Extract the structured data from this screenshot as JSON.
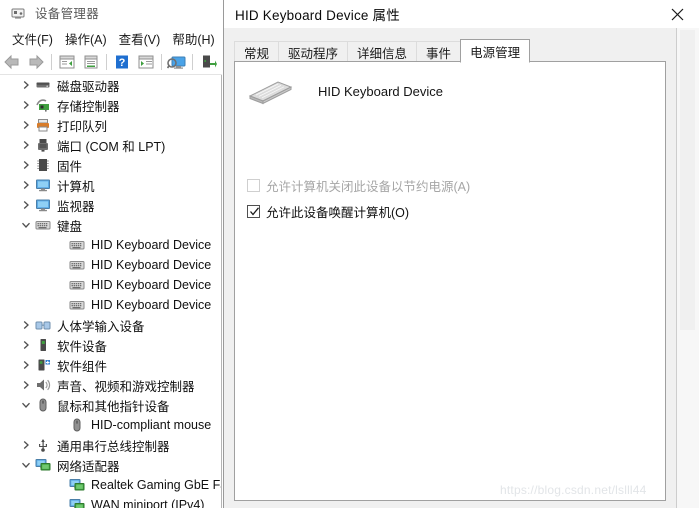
{
  "devmgr": {
    "title": "设备管理器",
    "title_icon": "device-manager-icon",
    "menu": [
      {
        "label": "文件(F)",
        "name": "menu-file"
      },
      {
        "label": "操作(A)",
        "name": "menu-action"
      },
      {
        "label": "查看(V)",
        "name": "menu-view"
      },
      {
        "label": "帮助(H)",
        "name": "menu-help"
      }
    ],
    "toolbar": [
      {
        "name": "back-arrow-icon",
        "kind": "back"
      },
      {
        "name": "forward-arrow-icon",
        "kind": "forward"
      },
      {
        "name": "separator",
        "kind": "sep"
      },
      {
        "name": "show-hide-console-tree-icon",
        "kind": "tree"
      },
      {
        "name": "properties-icon",
        "kind": "props"
      },
      {
        "name": "separator",
        "kind": "sep"
      },
      {
        "name": "help-icon",
        "kind": "help"
      },
      {
        "name": "update-driver-icon",
        "kind": "update"
      },
      {
        "name": "separator",
        "kind": "sep"
      },
      {
        "name": "scan-for-hardware-changes-icon",
        "kind": "scan"
      },
      {
        "name": "separator",
        "kind": "sep"
      },
      {
        "name": "add-legacy-hardware-icon",
        "kind": "addhw"
      }
    ],
    "tree": [
      {
        "label": "磁盘驱动器",
        "depth": 1,
        "expander": "collapsed",
        "icon": "disk-drive-icon"
      },
      {
        "label": "存储控制器",
        "depth": 1,
        "expander": "collapsed",
        "icon": "storage-controller-icon"
      },
      {
        "label": "打印队列",
        "depth": 1,
        "expander": "collapsed",
        "icon": "printer-icon"
      },
      {
        "label": "端口 (COM 和 LPT)",
        "depth": 1,
        "expander": "collapsed",
        "icon": "port-icon"
      },
      {
        "label": "固件",
        "depth": 1,
        "expander": "collapsed",
        "icon": "firmware-icon"
      },
      {
        "label": "计算机",
        "depth": 1,
        "expander": "collapsed",
        "icon": "computer-icon"
      },
      {
        "label": "监视器",
        "depth": 1,
        "expander": "collapsed",
        "icon": "monitor-icon"
      },
      {
        "label": "键盘",
        "depth": 1,
        "expander": "expanded",
        "icon": "keyboard-icon"
      },
      {
        "label": "HID Keyboard Device",
        "depth": 2,
        "expander": "none",
        "icon": "keyboard-icon"
      },
      {
        "label": "HID Keyboard Device",
        "depth": 2,
        "expander": "none",
        "icon": "keyboard-icon"
      },
      {
        "label": "HID Keyboard Device",
        "depth": 2,
        "expander": "none",
        "icon": "keyboard-icon"
      },
      {
        "label": "HID Keyboard Device",
        "depth": 2,
        "expander": "none",
        "icon": "keyboard-icon"
      },
      {
        "label": "人体学输入设备",
        "depth": 1,
        "expander": "collapsed",
        "icon": "hid-icon"
      },
      {
        "label": "软件设备",
        "depth": 1,
        "expander": "collapsed",
        "icon": "software-device-icon"
      },
      {
        "label": "软件组件",
        "depth": 1,
        "expander": "collapsed",
        "icon": "software-component-icon"
      },
      {
        "label": "声音、视频和游戏控制器",
        "depth": 1,
        "expander": "collapsed",
        "icon": "sound-icon"
      },
      {
        "label": "鼠标和其他指针设备",
        "depth": 1,
        "expander": "expanded",
        "icon": "mouse-icon"
      },
      {
        "label": "HID-compliant mouse",
        "depth": 2,
        "expander": "none",
        "icon": "mouse-icon"
      },
      {
        "label": "通用串行总线控制器",
        "depth": 1,
        "expander": "collapsed",
        "icon": "usb-icon"
      },
      {
        "label": "网络适配器",
        "depth": 1,
        "expander": "expanded",
        "icon": "network-adapter-icon"
      },
      {
        "label": "Realtek Gaming GbE Fam",
        "depth": 2,
        "expander": "none",
        "icon": "network-adapter-icon"
      },
      {
        "label": "WAN miniport (IPv4)",
        "depth": 2,
        "expander": "none",
        "icon": "network-adapter-icon"
      }
    ]
  },
  "dialog": {
    "title": "HID Keyboard Device 属性",
    "close_icon": "close-icon",
    "tabs": [
      {
        "label": "常规",
        "selected": false,
        "name": "tab-general"
      },
      {
        "label": "驱动程序",
        "selected": false,
        "name": "tab-driver"
      },
      {
        "label": "详细信息",
        "selected": false,
        "name": "tab-details"
      },
      {
        "label": "事件",
        "selected": false,
        "name": "tab-events"
      },
      {
        "label": "电源管理",
        "selected": true,
        "name": "tab-power-management"
      }
    ],
    "device": {
      "icon": "keyboard-device-icon",
      "name": "HID Keyboard Device"
    },
    "options": [
      {
        "label": "允许计算机关闭此设备以节约电源(A)",
        "checked": false,
        "disabled": true,
        "name": "checkbox-allow-computer-turn-off-device"
      },
      {
        "label": "允许此设备唤醒计算机(O)",
        "checked": true,
        "disabled": false,
        "name": "checkbox-allow-device-wake-computer"
      }
    ]
  },
  "watermark": {
    "text": "https://blog.csdn.net/lslll44"
  },
  "colors": {
    "accent_blue": "#1f6fd0",
    "icon_green": "#3f9f3f",
    "dialog_bg": "#f0f0f0",
    "content_bg": "#ffffff",
    "disabled_text": "#a6a6a6"
  }
}
